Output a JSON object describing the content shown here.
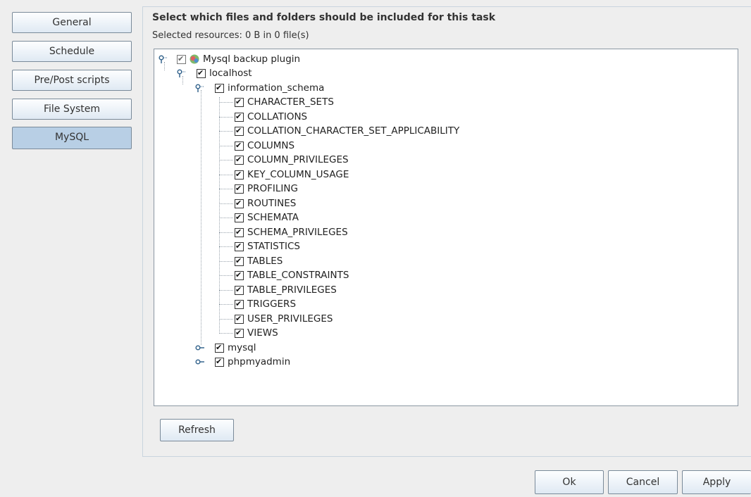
{
  "nav": {
    "general": "General",
    "schedule": "Schedule",
    "prepost": "Pre/Post scripts",
    "filesystem": "File System",
    "mysql": "MySQL"
  },
  "main": {
    "heading": "Select which files and folders should be included for this task",
    "selected": "Selected resources:  0 B in 0 file(s)"
  },
  "tree": {
    "root": "Mysql backup plugin",
    "host": "localhost",
    "schema": "information_schema",
    "tables": [
      "CHARACTER_SETS",
      "COLLATIONS",
      "COLLATION_CHARACTER_SET_APPLICABILITY",
      "COLUMNS",
      "COLUMN_PRIVILEGES",
      "KEY_COLUMN_USAGE",
      "PROFILING",
      "ROUTINES",
      "SCHEMATA",
      "SCHEMA_PRIVILEGES",
      "STATISTICS",
      "TABLES",
      "TABLE_CONSTRAINTS",
      "TABLE_PRIVILEGES",
      "TRIGGERS",
      "USER_PRIVILEGES",
      "VIEWS"
    ],
    "db_mysql": "mysql",
    "db_phpmyadmin": "phpmyadmin"
  },
  "buttons": {
    "refresh": "Refresh",
    "ok": "Ok",
    "cancel": "Cancel",
    "apply": "Apply"
  }
}
